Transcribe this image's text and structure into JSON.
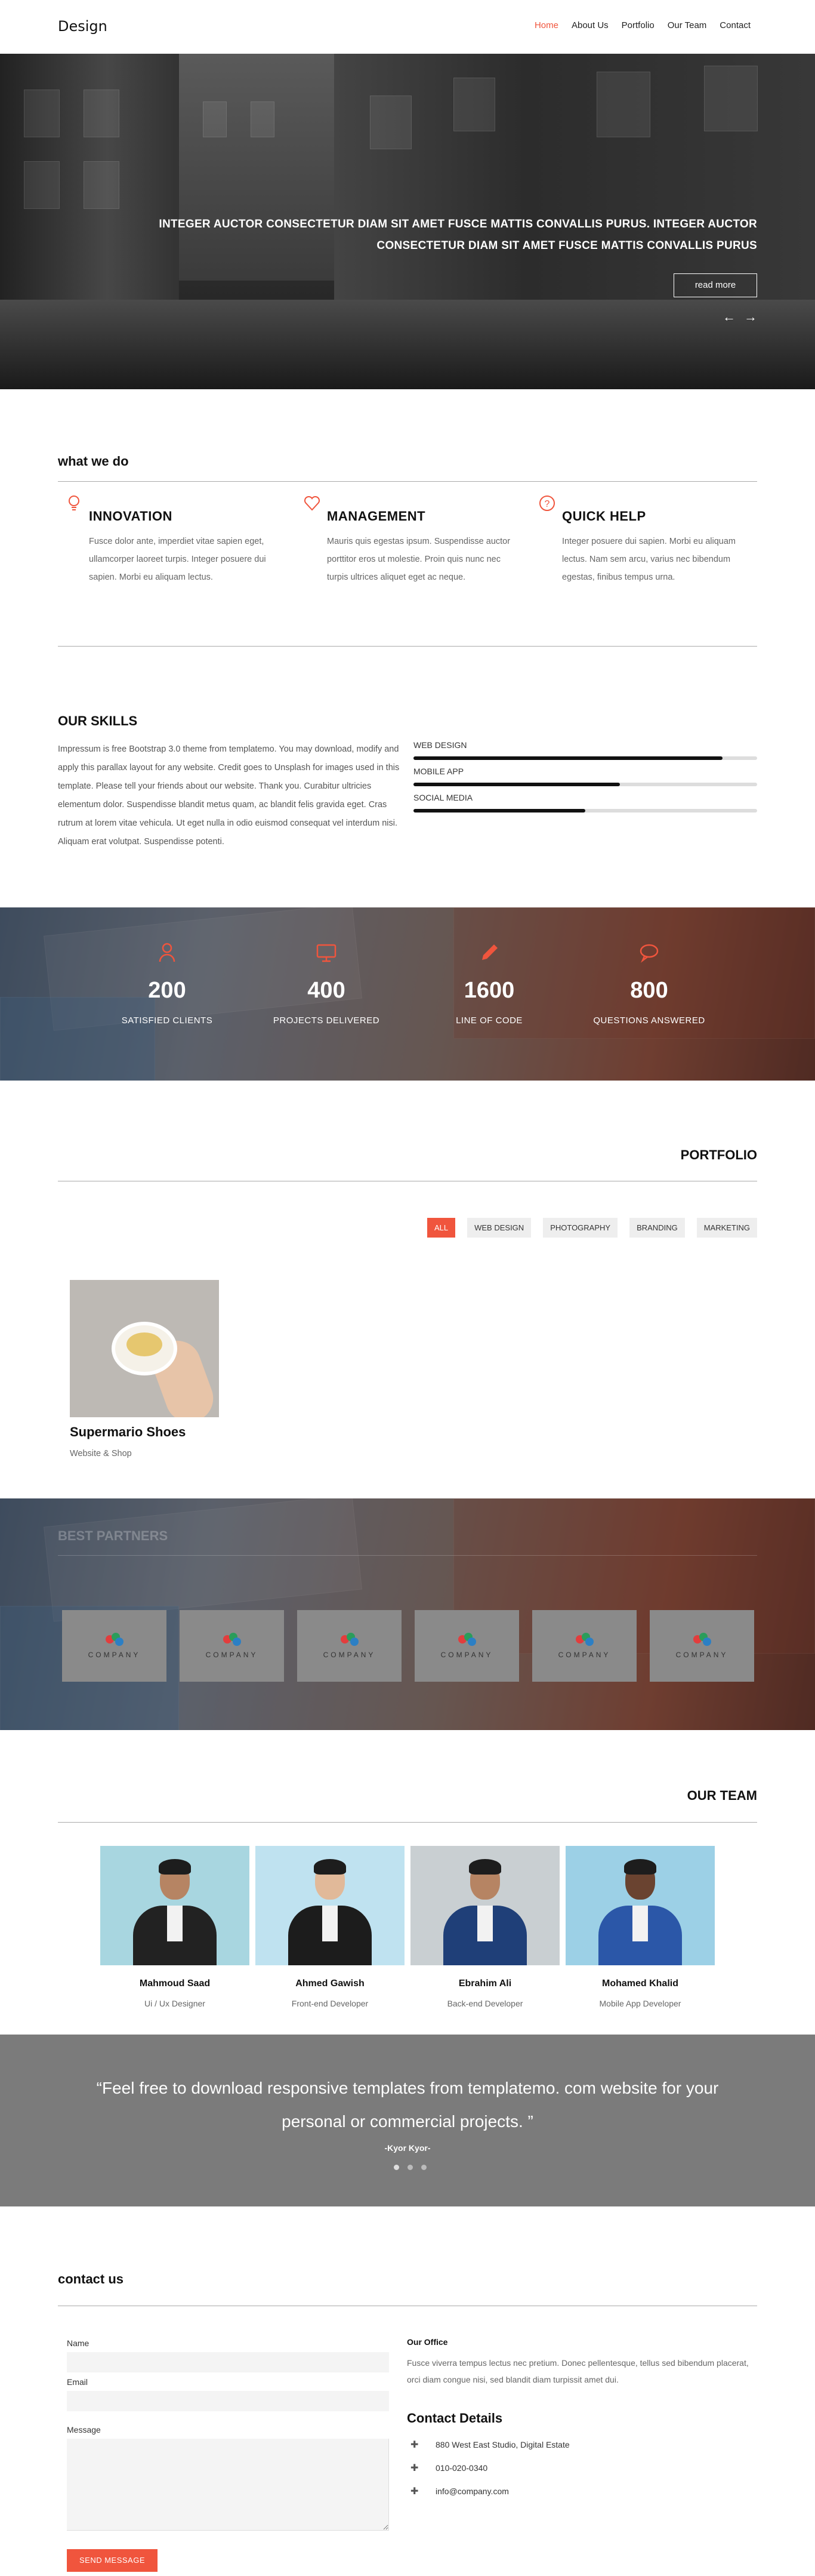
{
  "nav": {
    "logo": "Design",
    "items": [
      "Home",
      "About Us",
      "Portfolio",
      "Our Team",
      "Contact"
    ]
  },
  "hero": {
    "headline": "INTEGER AUCTOR CONSECTETUR DIAM SIT AMET FUSCE MATTIS CONVALLIS PURUS. INTEGER AUCTOR CONSECTETUR DIAM SIT AMET FUSCE MATTIS CONVALLIS PURUS",
    "button": "read more",
    "prev_icon": "arrow-left-icon",
    "next_icon": "arrow-right-icon"
  },
  "what_we_do": {
    "title": "what we do",
    "services": [
      {
        "icon": "lightbulb-icon",
        "title": "INNOVATION",
        "text": "Fusce dolor ante, imperdiet vitae sapien eget, ullamcorper laoreet turpis. Integer posuere dui sapien. Morbi eu aliquam lectus."
      },
      {
        "icon": "heart-icon",
        "title": "MANAGEMENT",
        "text": "Mauris quis egestas ipsum. Suspendisse auctor porttitor eros ut molestie. Proin quis nunc nec turpis ultrices aliquet eget ac neque."
      },
      {
        "icon": "question-icon",
        "title": "QUICK HELP",
        "text": "Integer posuere dui sapien. Morbi eu aliquam lectus. Nam sem arcu, varius nec bibendum egestas, finibus tempus urna."
      }
    ]
  },
  "skills": {
    "title": "OUR SKILLS",
    "text": "Impressum is free Bootstrap 3.0 theme from templatemo. You may download, modify and apply this parallax layout for any website. Credit goes to Unsplash for images used in this template. Please tell your friends about our website. Thank you. Curabitur ultricies elementum dolor. Suspendisse blandit metus quam, ac blandit felis gravida eget. Cras rutrum at lorem vitae vehicula. Ut eget nulla in odio euismod consequat vel interdum nisi. Aliquam erat volutpat. Suspendisse potenti.",
    "bars": [
      {
        "label": "WEB DESIGN",
        "level": 0.9
      },
      {
        "label": "MOBILE APP",
        "level": 0.6
      },
      {
        "label": "SOCIAL MEDIA",
        "level": 0.5
      }
    ]
  },
  "stats": [
    {
      "icon": "user-icon",
      "value": "200",
      "label": "SATISFIED CLIENTS"
    },
    {
      "icon": "desktop-icon",
      "value": "400",
      "label": "PROJECTS DELIVERED"
    },
    {
      "icon": "pencil-icon",
      "value": "1600",
      "label": "LINE OF CODE"
    },
    {
      "icon": "chat-icon",
      "value": "800",
      "label": "QUESTIONS ANSWERED"
    }
  ],
  "portfolio": {
    "title": "PORTFOLIO",
    "filters": [
      "ALL",
      "WEB DESIGN",
      "PHOTOGRAPHY",
      "BRANDING",
      "MARKETING"
    ],
    "item": {
      "title": "Supermario Shoes",
      "subtitle": "Website & Shop"
    }
  },
  "partners": {
    "title": "BEST PARTNERS",
    "logo_text": "COMPANY",
    "count": 6
  },
  "team": {
    "title": "OUR TEAM",
    "members": [
      {
        "name": "Mahmoud Saad",
        "role": "Ui / Ux Designer"
      },
      {
        "name": "Ahmed Gawish",
        "role": "Front-end Developer"
      },
      {
        "name": "Ebrahim Ali",
        "role": "Back-end Developer"
      },
      {
        "name": "Mohamed Khalid",
        "role": "Mobile App Developer"
      }
    ]
  },
  "testimonial": {
    "quote": "“Feel free to download responsive templates from templatemo. com website for your personal or commercial projects. ”",
    "author": "-Kyor Kyor-"
  },
  "contact": {
    "title": "contact us",
    "name_label": "Name",
    "email_label": "Email",
    "message_label": "Message",
    "send_label": "SEND MESSAGE",
    "office_title": "Our Office",
    "office_text": "Fusce viverra tempus lectus nec pretium. Donec pellentesque, tellus sed bibendum placerat, orci diam congue nisi, sed blandit diam turpissit amet dui.",
    "details_title": "Contact Details",
    "details": [
      {
        "icon": "location-icon",
        "text": "880 West East Studio, Digital Estate"
      },
      {
        "icon": "phone-icon",
        "text": "010-020-0340"
      },
      {
        "icon": "mail-icon",
        "text": "info@company.com"
      }
    ]
  },
  "colors": {
    "accent": "#f0553d",
    "text": "#333333",
    "muted": "#666666"
  }
}
